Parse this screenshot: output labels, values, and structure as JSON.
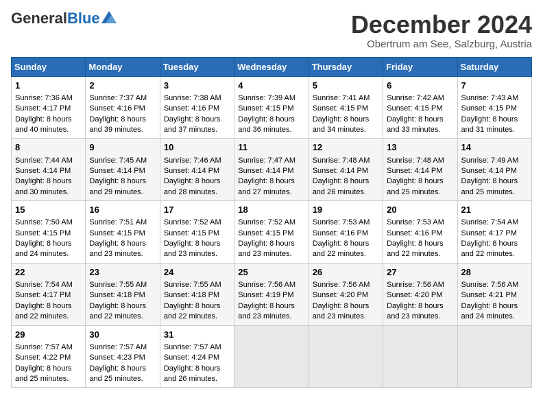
{
  "header": {
    "logo_general": "General",
    "logo_blue": "Blue",
    "month_title": "December 2024",
    "location": "Obertrum am See, Salzburg, Austria"
  },
  "calendar": {
    "days_of_week": [
      "Sunday",
      "Monday",
      "Tuesday",
      "Wednesday",
      "Thursday",
      "Friday",
      "Saturday"
    ],
    "weeks": [
      [
        {
          "day": "",
          "empty": true
        },
        {
          "day": "",
          "empty": true
        },
        {
          "day": "",
          "empty": true
        },
        {
          "day": "",
          "empty": true
        },
        {
          "day": "",
          "empty": true
        },
        {
          "day": "",
          "empty": true
        },
        {
          "day": "",
          "empty": true
        }
      ],
      [
        {
          "day": "1",
          "sunrise": "Sunrise: 7:36 AM",
          "sunset": "Sunset: 4:17 PM",
          "daylight": "Daylight: 8 hours and 40 minutes."
        },
        {
          "day": "2",
          "sunrise": "Sunrise: 7:37 AM",
          "sunset": "Sunset: 4:16 PM",
          "daylight": "Daylight: 8 hours and 39 minutes."
        },
        {
          "day": "3",
          "sunrise": "Sunrise: 7:38 AM",
          "sunset": "Sunset: 4:16 PM",
          "daylight": "Daylight: 8 hours and 37 minutes."
        },
        {
          "day": "4",
          "sunrise": "Sunrise: 7:39 AM",
          "sunset": "Sunset: 4:15 PM",
          "daylight": "Daylight: 8 hours and 36 minutes."
        },
        {
          "day": "5",
          "sunrise": "Sunrise: 7:41 AM",
          "sunset": "Sunset: 4:15 PM",
          "daylight": "Daylight: 8 hours and 34 minutes."
        },
        {
          "day": "6",
          "sunrise": "Sunrise: 7:42 AM",
          "sunset": "Sunset: 4:15 PM",
          "daylight": "Daylight: 8 hours and 33 minutes."
        },
        {
          "day": "7",
          "sunrise": "Sunrise: 7:43 AM",
          "sunset": "Sunset: 4:15 PM",
          "daylight": "Daylight: 8 hours and 31 minutes."
        }
      ],
      [
        {
          "day": "8",
          "sunrise": "Sunrise: 7:44 AM",
          "sunset": "Sunset: 4:14 PM",
          "daylight": "Daylight: 8 hours and 30 minutes."
        },
        {
          "day": "9",
          "sunrise": "Sunrise: 7:45 AM",
          "sunset": "Sunset: 4:14 PM",
          "daylight": "Daylight: 8 hours and 29 minutes."
        },
        {
          "day": "10",
          "sunrise": "Sunrise: 7:46 AM",
          "sunset": "Sunset: 4:14 PM",
          "daylight": "Daylight: 8 hours and 28 minutes."
        },
        {
          "day": "11",
          "sunrise": "Sunrise: 7:47 AM",
          "sunset": "Sunset: 4:14 PM",
          "daylight": "Daylight: 8 hours and 27 minutes."
        },
        {
          "day": "12",
          "sunrise": "Sunrise: 7:48 AM",
          "sunset": "Sunset: 4:14 PM",
          "daylight": "Daylight: 8 hours and 26 minutes."
        },
        {
          "day": "13",
          "sunrise": "Sunrise: 7:48 AM",
          "sunset": "Sunset: 4:14 PM",
          "daylight": "Daylight: 8 hours and 25 minutes."
        },
        {
          "day": "14",
          "sunrise": "Sunrise: 7:49 AM",
          "sunset": "Sunset: 4:14 PM",
          "daylight": "Daylight: 8 hours and 25 minutes."
        }
      ],
      [
        {
          "day": "15",
          "sunrise": "Sunrise: 7:50 AM",
          "sunset": "Sunset: 4:15 PM",
          "daylight": "Daylight: 8 hours and 24 minutes."
        },
        {
          "day": "16",
          "sunrise": "Sunrise: 7:51 AM",
          "sunset": "Sunset: 4:15 PM",
          "daylight": "Daylight: 8 hours and 23 minutes."
        },
        {
          "day": "17",
          "sunrise": "Sunrise: 7:52 AM",
          "sunset": "Sunset: 4:15 PM",
          "daylight": "Daylight: 8 hours and 23 minutes."
        },
        {
          "day": "18",
          "sunrise": "Sunrise: 7:52 AM",
          "sunset": "Sunset: 4:15 PM",
          "daylight": "Daylight: 8 hours and 23 minutes."
        },
        {
          "day": "19",
          "sunrise": "Sunrise: 7:53 AM",
          "sunset": "Sunset: 4:16 PM",
          "daylight": "Daylight: 8 hours and 22 minutes."
        },
        {
          "day": "20",
          "sunrise": "Sunrise: 7:53 AM",
          "sunset": "Sunset: 4:16 PM",
          "daylight": "Daylight: 8 hours and 22 minutes."
        },
        {
          "day": "21",
          "sunrise": "Sunrise: 7:54 AM",
          "sunset": "Sunset: 4:17 PM",
          "daylight": "Daylight: 8 hours and 22 minutes."
        }
      ],
      [
        {
          "day": "22",
          "sunrise": "Sunrise: 7:54 AM",
          "sunset": "Sunset: 4:17 PM",
          "daylight": "Daylight: 8 hours and 22 minutes."
        },
        {
          "day": "23",
          "sunrise": "Sunrise: 7:55 AM",
          "sunset": "Sunset: 4:18 PM",
          "daylight": "Daylight: 8 hours and 22 minutes."
        },
        {
          "day": "24",
          "sunrise": "Sunrise: 7:55 AM",
          "sunset": "Sunset: 4:18 PM",
          "daylight": "Daylight: 8 hours and 22 minutes."
        },
        {
          "day": "25",
          "sunrise": "Sunrise: 7:56 AM",
          "sunset": "Sunset: 4:19 PM",
          "daylight": "Daylight: 8 hours and 23 minutes."
        },
        {
          "day": "26",
          "sunrise": "Sunrise: 7:56 AM",
          "sunset": "Sunset: 4:20 PM",
          "daylight": "Daylight: 8 hours and 23 minutes."
        },
        {
          "day": "27",
          "sunrise": "Sunrise: 7:56 AM",
          "sunset": "Sunset: 4:20 PM",
          "daylight": "Daylight: 8 hours and 23 minutes."
        },
        {
          "day": "28",
          "sunrise": "Sunrise: 7:56 AM",
          "sunset": "Sunset: 4:21 PM",
          "daylight": "Daylight: 8 hours and 24 minutes."
        }
      ],
      [
        {
          "day": "29",
          "sunrise": "Sunrise: 7:57 AM",
          "sunset": "Sunset: 4:22 PM",
          "daylight": "Daylight: 8 hours and 25 minutes."
        },
        {
          "day": "30",
          "sunrise": "Sunrise: 7:57 AM",
          "sunset": "Sunset: 4:23 PM",
          "daylight": "Daylight: 8 hours and 25 minutes."
        },
        {
          "day": "31",
          "sunrise": "Sunrise: 7:57 AM",
          "sunset": "Sunset: 4:24 PM",
          "daylight": "Daylight: 8 hours and 26 minutes."
        },
        {
          "day": "",
          "empty": true
        },
        {
          "day": "",
          "empty": true
        },
        {
          "day": "",
          "empty": true
        },
        {
          "day": "",
          "empty": true
        }
      ]
    ]
  }
}
